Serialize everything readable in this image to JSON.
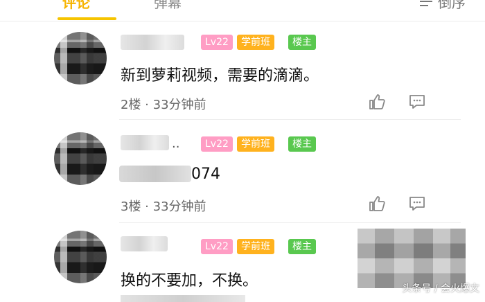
{
  "tabs": [
    {
      "label": "评论"
    },
    {
      "label": "弹幕"
    }
  ],
  "sort_label": "倒序",
  "comments": [
    {
      "badges": {
        "level": "Lv22",
        "school": "学前班",
        "owner": "楼主"
      },
      "text": "新到萝莉视频，需要的滴滴。",
      "floor_time": "2楼 · 33分钟前"
    },
    {
      "name_suffix": "..",
      "badges": {
        "level": "Lv22",
        "school": "学前班",
        "owner": "楼主"
      },
      "text_visible": "074",
      "floor_time": "3楼 · 33分钟前"
    },
    {
      "badges": {
        "level": "Lv22",
        "school": "学前班",
        "owner": "楼主"
      },
      "text": "换的不要加，不换。"
    }
  ],
  "watermark": "头条号 / 会火爆文",
  "colors": {
    "accent": "#f6c400",
    "level_badge": "#ff9dc4",
    "school_badge": "#ffb21e",
    "owner_badge": "#59c84f"
  },
  "icons": [
    "thumbs-up-icon",
    "comment-icon"
  ]
}
